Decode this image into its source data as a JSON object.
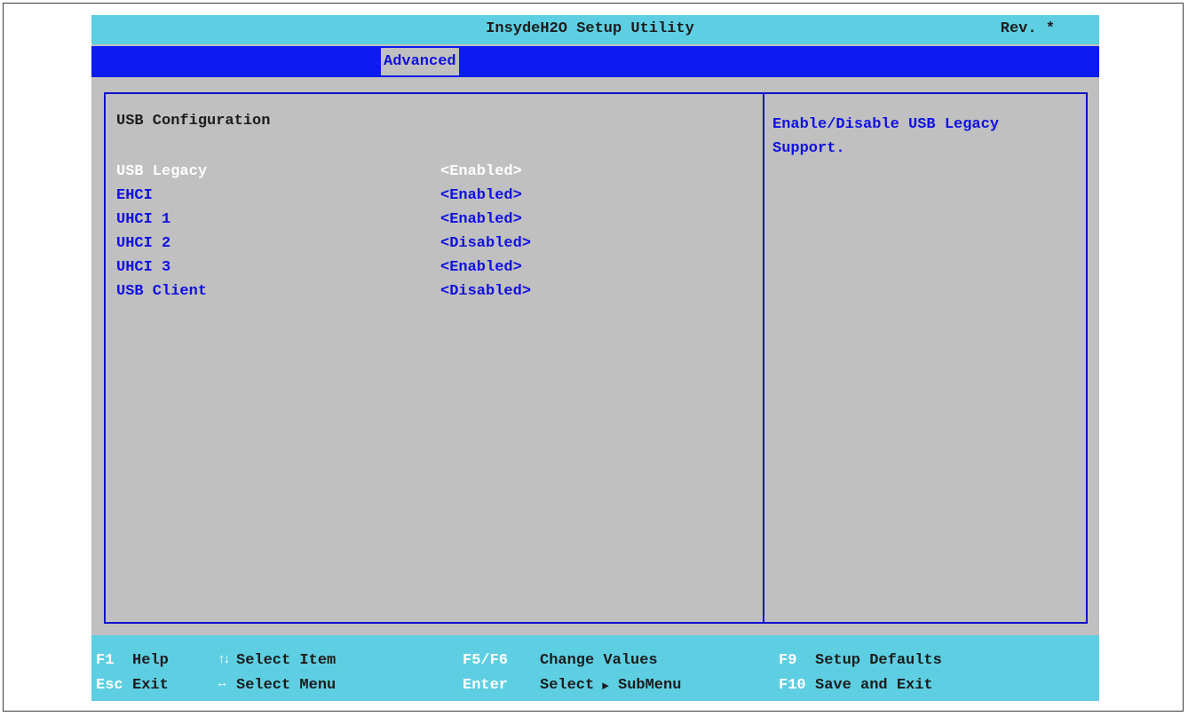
{
  "title": "InsydeH2O Setup Utility",
  "revision": "Rev. *",
  "tabs": [
    {
      "label": "Advanced",
      "active": true
    }
  ],
  "section_title": "USB Configuration",
  "settings": [
    {
      "label": "USB Legacy",
      "value": "<Enabled>",
      "selected": true
    },
    {
      "label": "EHCI",
      "value": "<Enabled>"
    },
    {
      "label": "UHCI 1",
      "value": "<Enabled>"
    },
    {
      "label": "UHCI 2",
      "value": "<Disabled>"
    },
    {
      "label": "UHCI 3",
      "value": "<Enabled>"
    },
    {
      "label": "USB Client",
      "value": "<Disabled>"
    }
  ],
  "help_text": "Enable/Disable USB Legacy Support.",
  "footer": {
    "f1_key": "F1",
    "f1_action": "Help",
    "esc_key": "Esc",
    "esc_action": "Exit",
    "updown_icon": "↑↓",
    "updown_action": "Select Item",
    "leftright_icon": "↔",
    "leftright_action": "Select Menu",
    "f5f6_key": "F5/F6",
    "f5f6_action": "Change Values",
    "enter_key": "Enter",
    "enter_action": "Select",
    "submenu_icon": "►",
    "submenu_action": "SubMenu",
    "f9_key": "F9",
    "f9_action": "Setup Defaults",
    "f10_key": "F10",
    "f10_action": "Save and Exit"
  },
  "colors": {
    "title_bar": "#5ecfe2",
    "menu_bar": "#0d1bf0",
    "panel_bg": "#c0c0c0",
    "text_blue": "#1010e0",
    "selected_text": "#ffffff"
  }
}
